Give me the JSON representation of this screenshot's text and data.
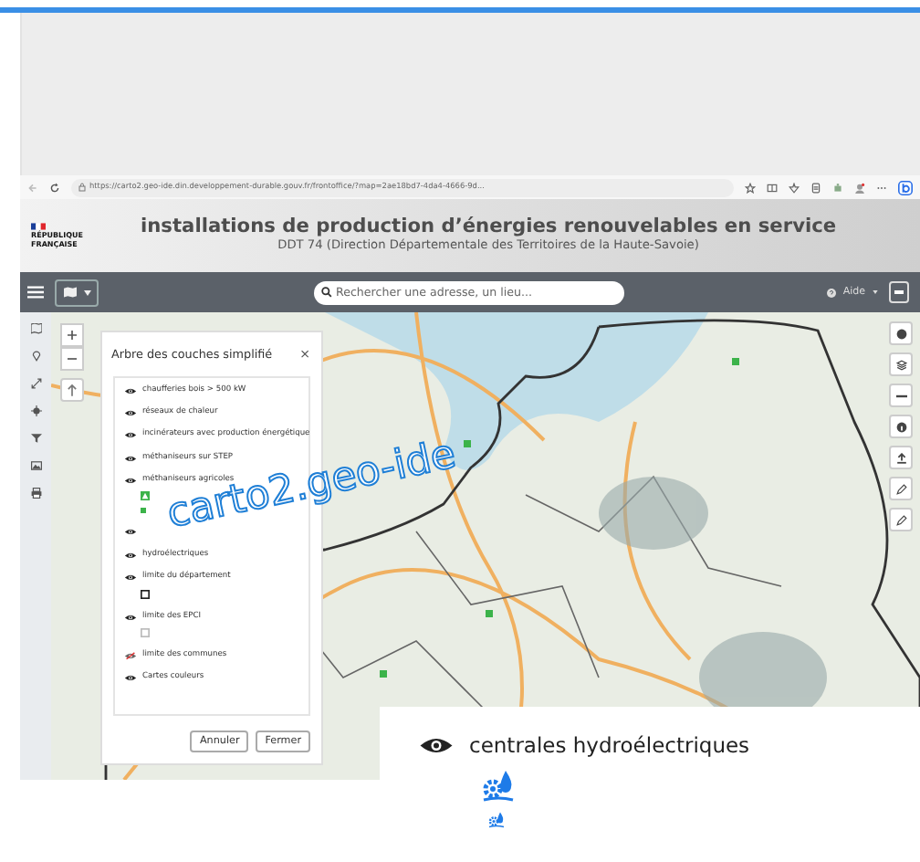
{
  "browser": {
    "url": "https://carto2.geo-ide.din.developpement-durable.gouv.fr/frontoffice/?map=2ae18bd7-4da4-4666-9d..."
  },
  "header": {
    "logo_lines": [
      "RÉPUBLIQUE",
      "FRANÇAISE"
    ],
    "title": "installations de production d’énergies renouvelables en service",
    "subtitle": "DDT 74 (Direction Départementale des Territoires de la Haute-Savoie)"
  },
  "navbar": {
    "search_placeholder": "Rechercher une adresse, un lieu...",
    "help": "Aide"
  },
  "layer_panel": {
    "title": "Arbre des couches simplifié",
    "close": "×",
    "layers": [
      {
        "kind": "plain",
        "label": "chaufferies bois > 500 kW",
        "visible": true
      },
      {
        "kind": "plain",
        "label": "réseaux de chaleur",
        "visible": true
      },
      {
        "kind": "plain",
        "label": "incinérateurs avec production énergétique",
        "visible": true
      },
      {
        "kind": "plain",
        "label": "méthaniseurs sur STEP",
        "visible": true
      },
      {
        "kind": "symbol",
        "label": "méthaniseurs agricoles",
        "visible": true
      },
      {
        "kind": "plain",
        "visible": true
      },
      {
        "kind": "plain",
        "label": "hydroélectriques",
        "visible": true
      },
      {
        "kind": "outline",
        "label": "limite du département",
        "visible": true
      },
      {
        "kind": "faint",
        "label": "limite des EPCI",
        "visible": true
      },
      {
        "kind": "plain",
        "label": "limite des communes",
        "visible": false
      },
      {
        "kind": "plain",
        "label": "Cartes couleurs",
        "visible": true
      }
    ],
    "buttons": [
      "Annuler",
      "Fermer"
    ]
  },
  "annotation": "carto2.geo-ide",
  "inset": {
    "label": "centrales hydroélectriques",
    "visible": true
  }
}
